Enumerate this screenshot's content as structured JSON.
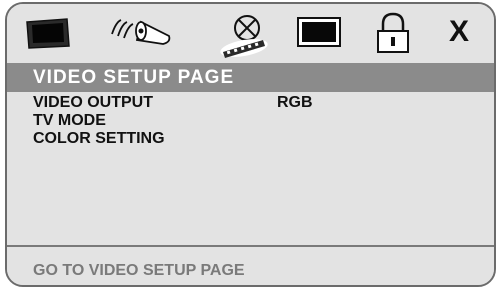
{
  "icons": [
    {
      "name": "general-setup-icon",
      "selected": false
    },
    {
      "name": "audio-setup-icon",
      "selected": false
    },
    {
      "name": "video-setup-icon",
      "selected": true
    },
    {
      "name": "preference-icon",
      "selected": false
    },
    {
      "name": "password-lock-icon",
      "selected": false
    },
    {
      "name": "exit-icon",
      "selected": false,
      "glyph": "X"
    }
  ],
  "page": {
    "title": "VIDEO SETUP PAGE",
    "menu": [
      {
        "label": "VIDEO OUTPUT",
        "value": "RGB"
      },
      {
        "label": "TV MODE",
        "value": ""
      },
      {
        "label": "COLOR SETTING",
        "value": ""
      }
    ]
  },
  "status": {
    "text": "GO TO VIDEO SETUP PAGE"
  },
  "colors": {
    "background": "#e3e3e3",
    "title_bar": "#8b8b8b",
    "border": "#6b6b6b",
    "status_text": "#7a7a7a"
  }
}
